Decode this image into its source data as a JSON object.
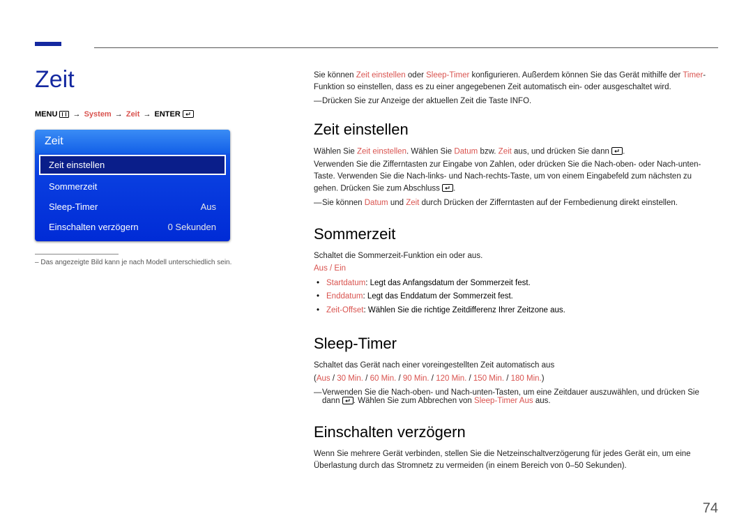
{
  "pageTitle": "Zeit",
  "breadcrumb": {
    "menu": "MENU",
    "system": "System",
    "zeit": "Zeit",
    "enter": "ENTER"
  },
  "osd": {
    "header": "Zeit",
    "items": [
      {
        "label": "Zeit einstellen",
        "value": "",
        "selected": true
      },
      {
        "label": "Sommerzeit",
        "value": ""
      },
      {
        "label": "Sleep-Timer",
        "value": "Aus"
      },
      {
        "label": "Einschalten verzögern",
        "value": "0 Sekunden"
      }
    ]
  },
  "footnote": "Das angezeigte Bild kann je nach Modell unterschiedlich sein.",
  "intro": {
    "line1a": "Sie können ",
    "line1b": "Zeit einstellen",
    "line1c": " oder ",
    "line1d": "Sleep-Timer",
    "line1e": " konfigurieren. Außerdem können Sie das Gerät mithilfe der ",
    "line1f": "Timer",
    "line1g": "-Funktion so einstellen, dass es zu einer angegebenen Zeit automatisch ein- oder ausgeschaltet wird.",
    "note": "Drücken Sie zur Anzeige der aktuellen Zeit die Taste INFO."
  },
  "sections": {
    "zeitEinstellen": {
      "title": "Zeit einstellen",
      "p1a": "Wählen Sie ",
      "p1b": "Zeit einstellen",
      "p1c": ". Wählen Sie ",
      "p1d": "Datum",
      "p1e": " bzw. ",
      "p1f": "Zeit",
      "p1g": " aus, und drücken Sie dann ",
      "p1h": ".",
      "p2": "Verwenden Sie die Zifferntasten zur Eingabe von Zahlen, oder drücken Sie die Nach-oben- oder Nach-unten-Taste. Verwenden Sie die Nach-links- und Nach-rechts-Taste, um von einem Eingabefeld zum nächsten zu gehen. Drücken Sie zum Abschluss ",
      "p2b": ".",
      "noteA": "Sie können ",
      "noteB": "Datum",
      "noteC": " und ",
      "noteD": "Zeit",
      "noteE": " durch Drücken der Zifferntasten auf der Fernbedienung direkt einstellen."
    },
    "sommerzeit": {
      "title": "Sommerzeit",
      "p1": "Schaltet die Sommerzeit-Funktion ein oder aus.",
      "opt1": "Aus",
      "optSep": " / ",
      "opt2": "Ein",
      "b1a": "Startdatum",
      "b1b": ": Legt das Anfangsdatum der Sommerzeit fest.",
      "b2a": "Enddatum",
      "b2b": ": Legt das Enddatum der Sommerzeit fest.",
      "b3a": "Zeit-Offset",
      "b3b": ": Wählen Sie die richtige Zeitdifferenz Ihrer Zeitzone aus."
    },
    "sleepTimer": {
      "title": "Sleep-Timer",
      "p1": "Schaltet das Gerät nach einer voreingestellten Zeit automatisch aus",
      "optsOpen": "(",
      "o1": "Aus",
      "s": " / ",
      "o2": "30 Min.",
      "o3": "60 Min.",
      "o4": "90 Min.",
      "o5": "120 Min.",
      "o6": "150 Min.",
      "o7": "180 Min.",
      "optsClose": ")",
      "note1": "Verwenden Sie die Nach-oben- und Nach-unten-Tasten, um eine Zeitdauer auszuwählen, und drücken Sie dann ",
      "note2": ". Wählen Sie zum Abbrechen von ",
      "note3": "Sleep-Timer",
      "note4": " ",
      "note5": "Aus",
      "note6": " aus."
    },
    "einschalten": {
      "title": "Einschalten verzögern",
      "p1": "Wenn Sie mehrere Gerät verbinden, stellen Sie die Netzeinschaltverzögerung für jedes Gerät ein, um eine Überlastung durch das Stromnetz zu vermeiden (in einem Bereich von 0–50 Sekunden)."
    }
  },
  "pageNumber": "74"
}
